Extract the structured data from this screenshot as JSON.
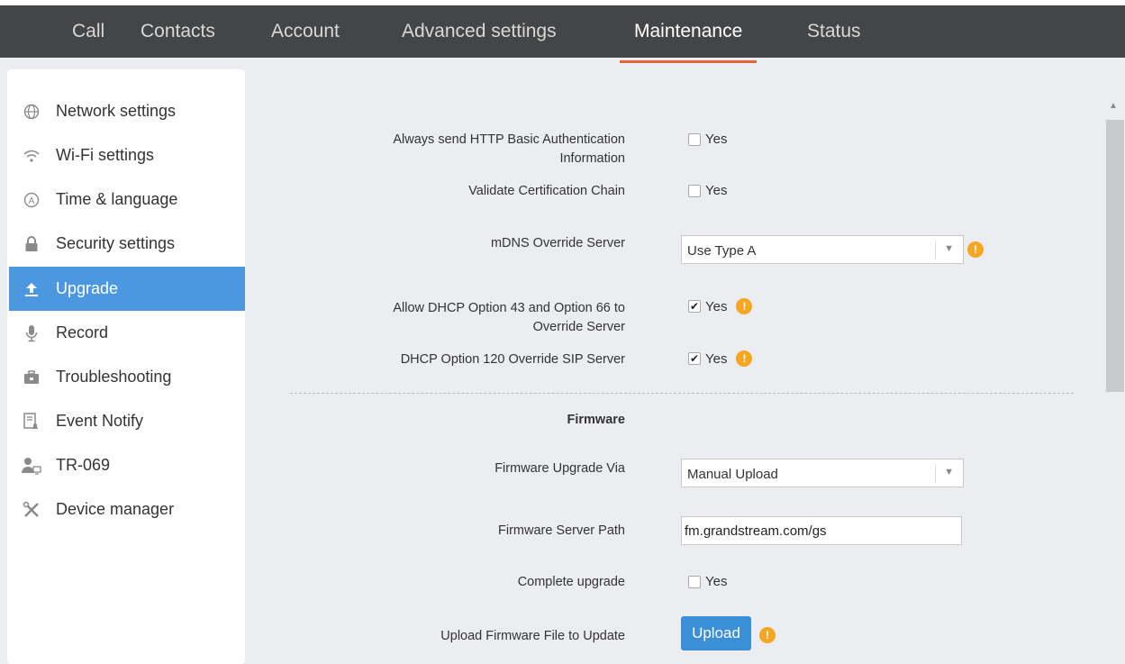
{
  "nav": {
    "tabs": [
      {
        "label": "Call"
      },
      {
        "label": "Contacts"
      },
      {
        "label": "Account"
      },
      {
        "label": "Advanced settings"
      },
      {
        "label": "Maintenance",
        "active": true
      },
      {
        "label": "Status"
      }
    ]
  },
  "sidebar": {
    "items": [
      {
        "label": "Network settings",
        "icon": "globe-icon"
      },
      {
        "label": "Wi-Fi settings",
        "icon": "wifi-icon"
      },
      {
        "label": "Time & language",
        "icon": "language-icon"
      },
      {
        "label": "Security settings",
        "icon": "lock-icon"
      },
      {
        "label": "Upgrade",
        "icon": "upload-icon",
        "active": true
      },
      {
        "label": "Record",
        "icon": "microphone-icon"
      },
      {
        "label": "Troubleshooting",
        "icon": "toolbox-icon"
      },
      {
        "label": "Event Notify",
        "icon": "notification-icon"
      },
      {
        "label": "TR-069",
        "icon": "user-device-icon"
      },
      {
        "label": "Device manager",
        "icon": "tools-icon"
      }
    ]
  },
  "form": {
    "http_auth": {
      "label_line1": "Always send HTTP Basic Authentication",
      "label_line2": "Information",
      "option": "Yes",
      "checked": false
    },
    "validate_chain": {
      "label": "Validate Certification Chain",
      "option": "Yes",
      "checked": false
    },
    "mdns": {
      "label": "mDNS Override Server",
      "value": "Use Type A"
    },
    "dhcp43": {
      "label_line1": "Allow DHCP Option 43 and Option 66 to",
      "label_line2": "Override Server",
      "option": "Yes",
      "checked": true
    },
    "dhcp120": {
      "label": "DHCP Option 120 Override SIP Server",
      "option": "Yes",
      "checked": true
    },
    "firmware_section": "Firmware",
    "upgrade_via": {
      "label": "Firmware Upgrade Via",
      "value": "Manual Upload"
    },
    "server_path": {
      "label": "Firmware Server Path",
      "value": "fm.grandstream.com/gs"
    },
    "complete_upgrade": {
      "label": "Complete upgrade",
      "option": "Yes",
      "checked": false
    },
    "upload_file": {
      "label": "Upload Firmware File to Update",
      "button": "Upload"
    }
  },
  "colors": {
    "accent": "#e8623b",
    "active_item": "#4c98e0",
    "warning": "#f5a623",
    "topbar": "#444546"
  }
}
